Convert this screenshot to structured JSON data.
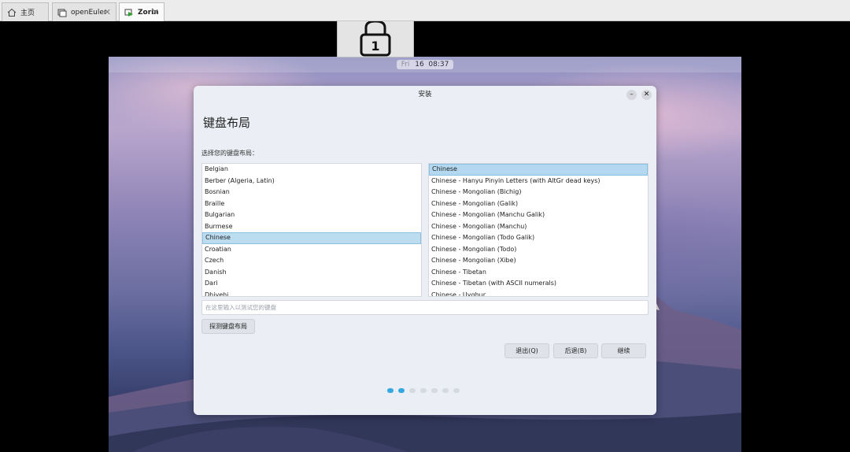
{
  "host_tabs": [
    {
      "label": "主页",
      "icon": "home-icon",
      "active": false
    },
    {
      "label": "openEuler",
      "icon": "vm-window-icon",
      "active": false
    },
    {
      "label": "Zorin",
      "icon": "vm-running-icon",
      "active": true
    }
  ],
  "vm": {
    "lock_label": "1",
    "clock": {
      "day": "Fri",
      "date": "16",
      "time": "08:37"
    }
  },
  "installer": {
    "title": "安装",
    "heading": "键盘布局",
    "prompt": "选择您的键盘布局：",
    "layouts": [
      "Belgian",
      "Berber (Algeria, Latin)",
      "Bosnian",
      "Braille",
      "Bulgarian",
      "Burmese",
      "Chinese",
      "Croatian",
      "Czech",
      "Danish",
      "Dari",
      "Dhivehi"
    ],
    "selected_layout_index": 6,
    "variants": [
      "Chinese",
      "Chinese - Hanyu Pinyin Letters (with AltGr dead keys)",
      "Chinese - Mongolian (Bichig)",
      "Chinese - Mongolian (Galik)",
      "Chinese - Mongolian (Manchu Galik)",
      "Chinese - Mongolian (Manchu)",
      "Chinese - Mongolian (Todo Galik)",
      "Chinese - Mongolian (Todo)",
      "Chinese - Mongolian (Xibe)",
      "Chinese - Tibetan",
      "Chinese - Tibetan (with ASCII numerals)",
      "Chinese - Uyghur"
    ],
    "selected_variant_index": 0,
    "test_placeholder": "在这里输入以测试您的键盘",
    "detect_label": "探测键盘布局",
    "quit_label": "退出(Q)",
    "back_label": "后退(B)",
    "continue_label": "继续",
    "progress": {
      "total_steps": 7,
      "current_step": 2
    },
    "accent_color": "#36a8e0"
  }
}
